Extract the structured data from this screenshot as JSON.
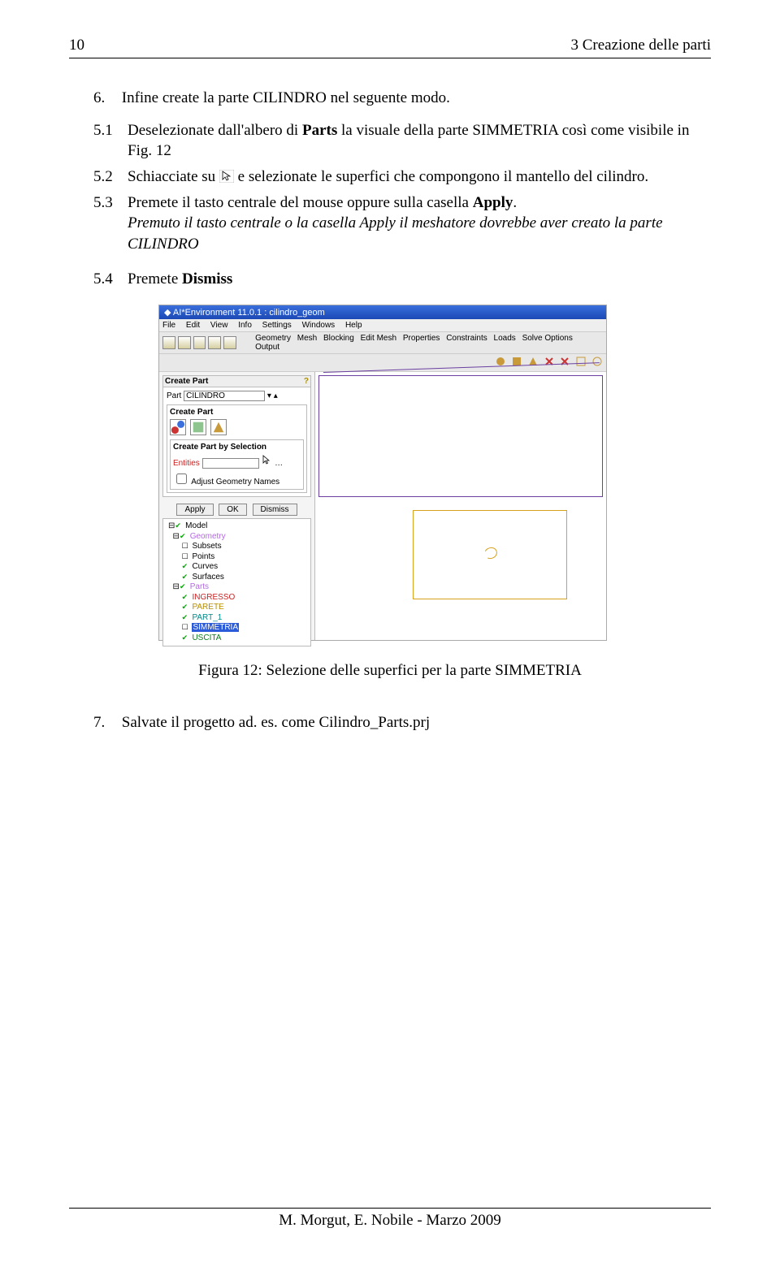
{
  "header": {
    "left": "10",
    "right": "3   Creazione delle parti"
  },
  "intro_para_num": "6.",
  "intro_para": "Infine create la parte CILINDRO nel seguente modo.",
  "steps": [
    {
      "num": "5.1",
      "pre": "Deselezionate dall'albero di ",
      "bold": "Parts",
      "post": " la visuale della parte SIMMETRIA così come visibile in Fig. 12"
    },
    {
      "num": "5.2",
      "pre": "Schiacciate su ",
      "post": " e selezionate le superfici che compongono il mantello del cilindro."
    },
    {
      "num": "5.3",
      "pre": "Premete il tasto centrale del mouse oppure sulla casella ",
      "bold": "Apply",
      "post": ".",
      "italic": "Premuto il tasto centrale o la casella Apply il meshatore dovrebbe aver creato la parte CILINDRO"
    },
    {
      "num": "5.4",
      "pre": "Premete ",
      "bold": "Dismiss",
      "post": ""
    }
  ],
  "shot": {
    "title": "AI*Environment 11.0.1 : cilindro_geom",
    "menu": [
      "File",
      "Edit",
      "View",
      "Info",
      "Settings",
      "Windows",
      "Help"
    ],
    "tabs": [
      "Geometry",
      "Mesh",
      "Blocking",
      "Edit Mesh",
      "Properties",
      "Constraints",
      "Loads",
      "Solve Options",
      "Output"
    ],
    "createPart": {
      "panelTitle": "Create Part",
      "partLabel": "Part",
      "partValue": "CILINDRO",
      "subTitle": "Create Part",
      "bySelection": "Create Part by Selection",
      "entitiesLabel": "Entities",
      "adjustLabel": "Adjust Geometry Names"
    },
    "buttons": {
      "apply": "Apply",
      "ok": "OK",
      "dismiss": "Dismiss"
    },
    "tree": {
      "model": "Model",
      "geometry": "Geometry",
      "subsets": "Subsets",
      "points": "Points",
      "curves": "Curves",
      "surfaces": "Surfaces",
      "parts": "Parts",
      "ingresso": "INGRESSO",
      "parete": "PARETE",
      "part1": "PART_1",
      "simmetria": "SIMMETRIA",
      "uscita": "USCITA"
    }
  },
  "figcaption": "Figura 12: Selezione delle superfici per la parte SIMMETRIA",
  "final_num": "7.",
  "final_txt": "Salvate il progetto ad. es. come Cilindro_Parts.prj",
  "footer": "M. Morgut, E. Nobile - Marzo 2009"
}
